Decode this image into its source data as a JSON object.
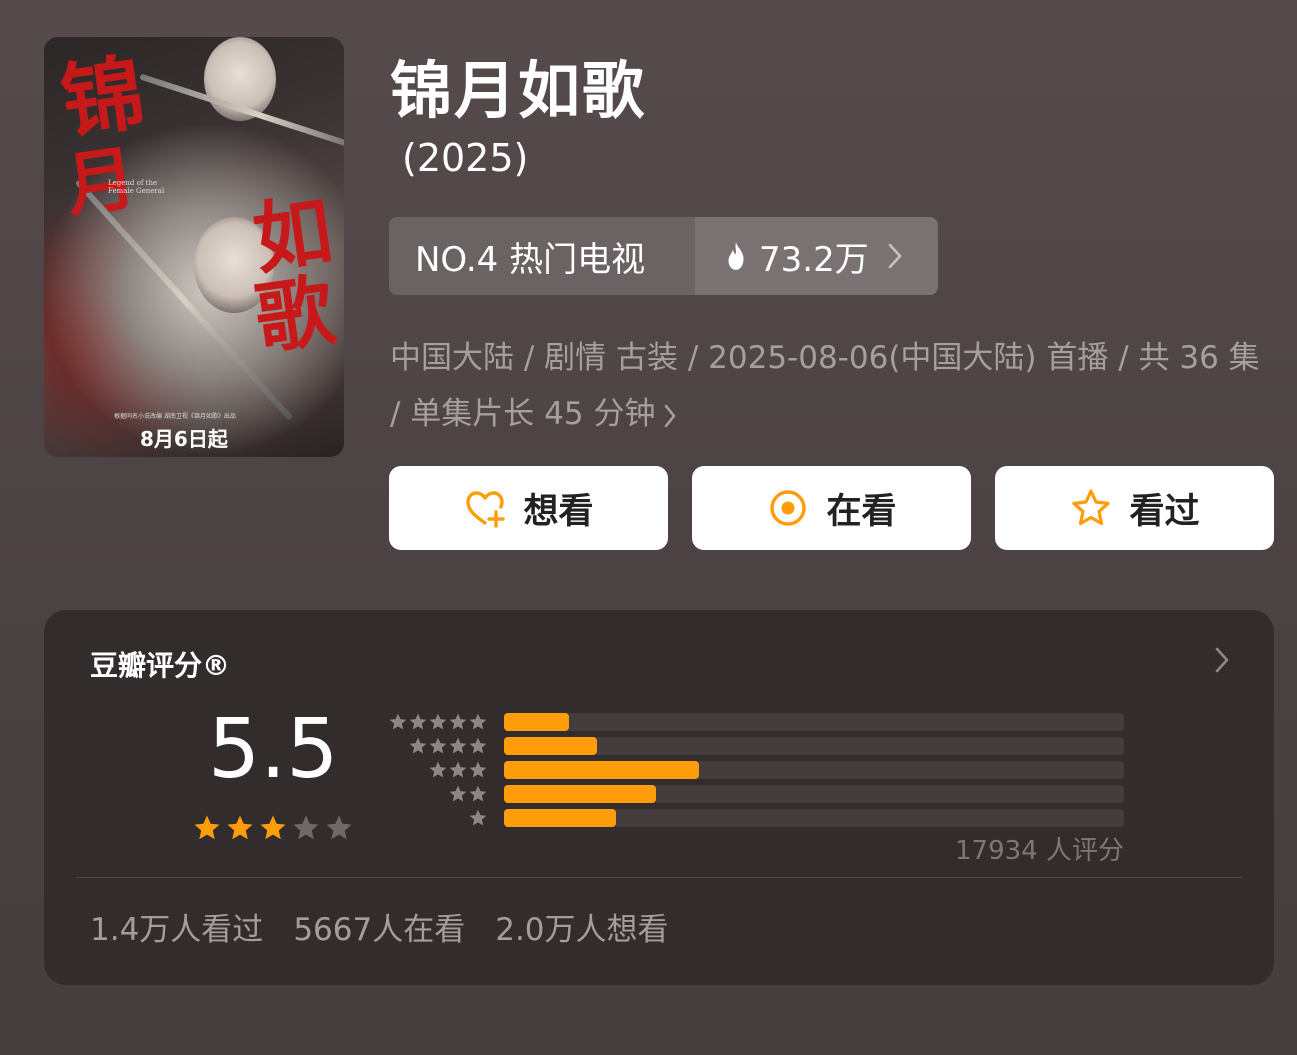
{
  "poster": {
    "title_chars": [
      "锦",
      "月",
      "如",
      "歌"
    ],
    "english_title": "Legend of the Female General",
    "release_text": "8月6日起",
    "credit_text": "根据同名小说改编 湖南卫视《锦月如歌》出品"
  },
  "header": {
    "title": "锦月如歌",
    "year": "(2025)"
  },
  "rank": {
    "label": "NO.4 热门电视",
    "heat": "73.2万"
  },
  "meta": {
    "text": "中国大陆 / 剧情 古装 / 2025-08-06(中国大陆) 首播 / 共 36 集 / 单集片长 45 分钟"
  },
  "actions": {
    "want": "想看",
    "doing": "在看",
    "done": "看过"
  },
  "rating": {
    "title": "豆瓣评分®",
    "score": "5.5",
    "stars_filled": 3,
    "stars_total": 5,
    "distribution": [
      {
        "stars": 5,
        "fraction": 0.105
      },
      {
        "stars": 4,
        "fraction": 0.15
      },
      {
        "stars": 3,
        "fraction": 0.315
      },
      {
        "stars": 2,
        "fraction": 0.245
      },
      {
        "stars": 1,
        "fraction": 0.18
      }
    ],
    "raters": "17934 人评分"
  },
  "counts": {
    "watched": "1.4万人看过",
    "watching": "5667人在看",
    "wish": "2.0万人想看"
  },
  "colors": {
    "accent": "#ff9e0a",
    "card_bg": "#332c2d",
    "page_bg": "#4d4445",
    "star_empty": "#6f6869"
  }
}
